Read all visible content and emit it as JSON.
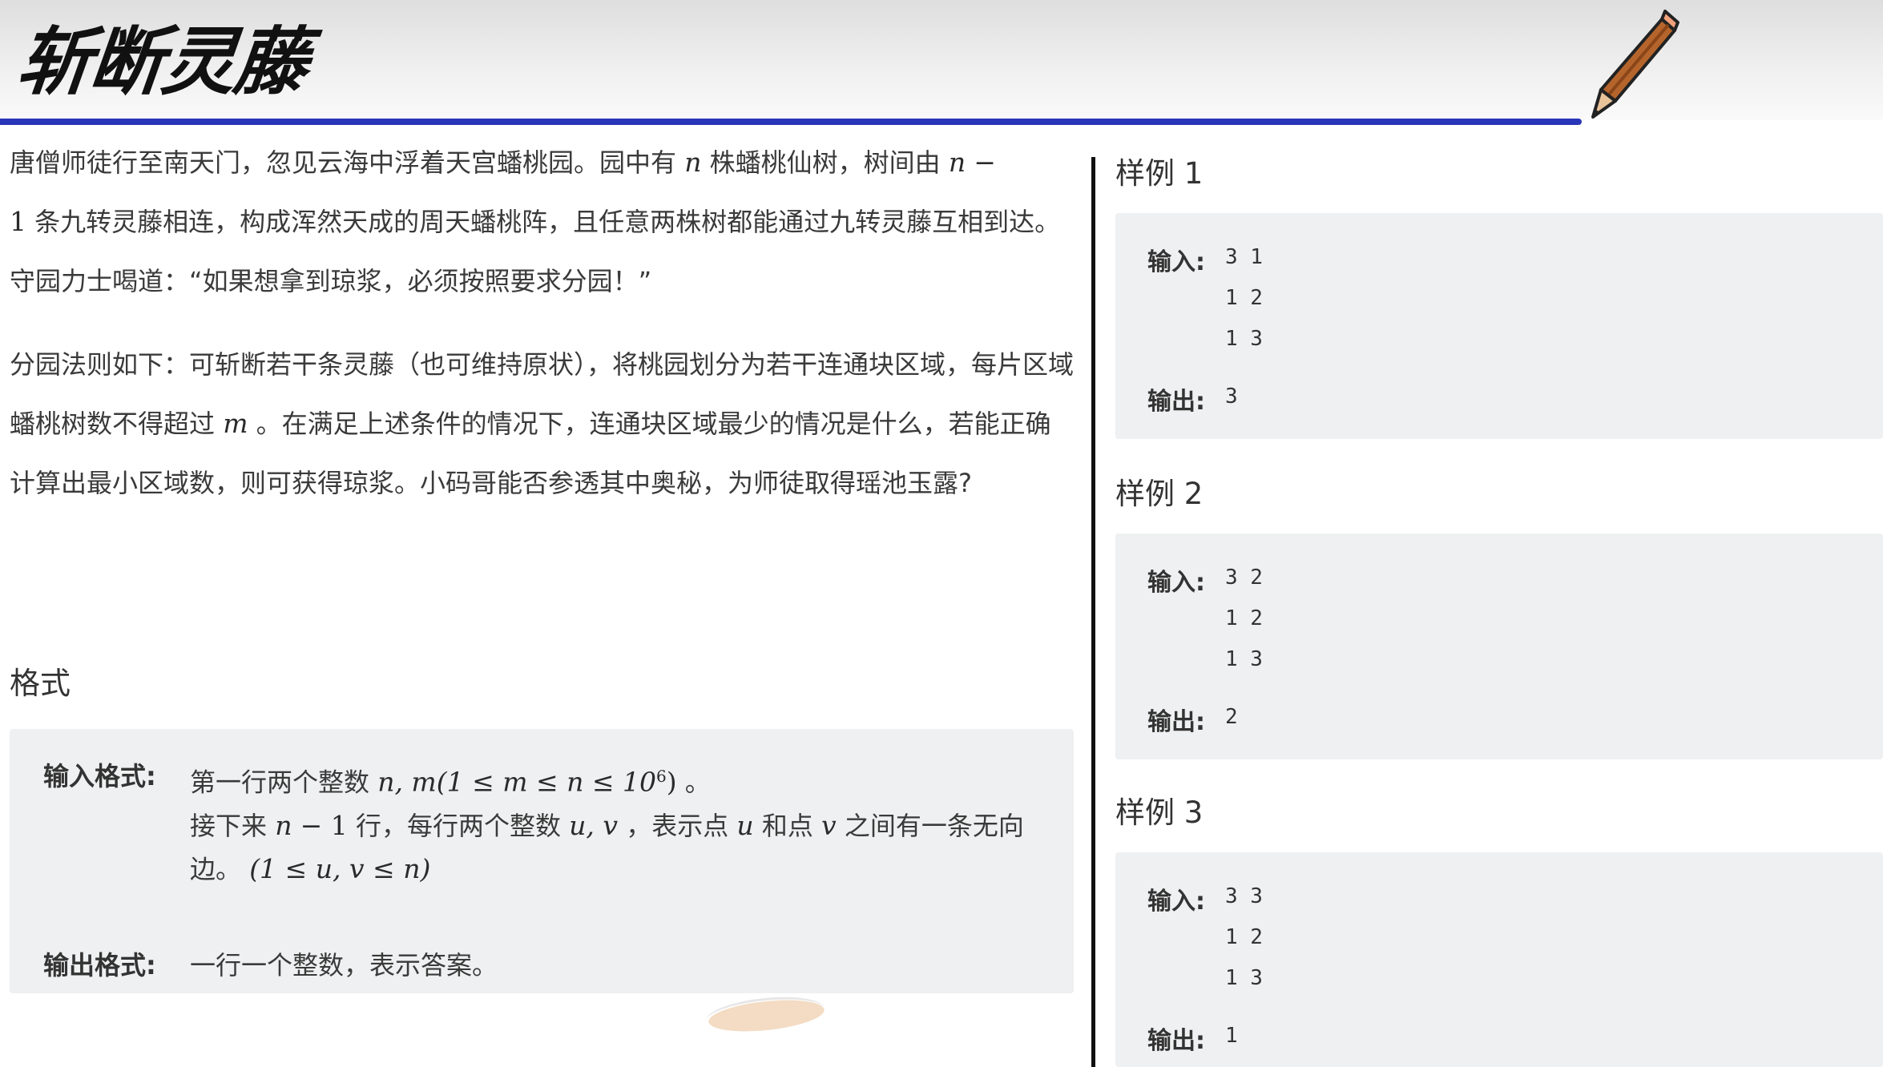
{
  "header": {
    "title": "斩断灵藤",
    "accent_color": "#2a36b8",
    "decoration_icon": "pencil-icon"
  },
  "statement": {
    "p1": {
      "t1": "唐僧师徒行至南天门，忽见云海中浮着天宫蟠桃园。园中有",
      "m1": "n",
      "t2": "株蟠桃仙树，树间由",
      "m2": "n",
      "m2b": "−",
      "m2c": "1",
      "t3": "条九转灵藤相连，构成浑然天成的周天蟠桃阵，且任意两株树都能通过九转灵藤互相到达。守园力士喝道：“如果想拿到琼浆，必须按照要求分园！”"
    },
    "p2": {
      "t1": "分园法则如下：可斩断若干条灵藤（也可维持原状），将桃园划分为若干连通块区域，每片区域蟠桃树数不得超过",
      "m1": "m",
      "t2": "。在满足上述条件的情况下，连通块区域最少的情况是什么，若能正确计算出最小区域数，则可获得琼浆。小码哥能否参透其中奥秘，为师徒取得瑶池玉露?"
    }
  },
  "format": {
    "section_title": "格式",
    "input_label": "输入格式:",
    "input_t1": "第一行两个整数",
    "input_m1": "n, m",
    "input_m2": "(1 ≤ m ≤ n ≤ 10",
    "input_m2_sup": "6",
    "input_m2_end": ")",
    "input_t2": "。",
    "input_t3": "接下来",
    "input_m3": "n",
    "input_m3b": "− 1",
    "input_t4": "行，每行两个整数",
    "input_m4": "u, v",
    "input_t5": "，表示点",
    "input_m5": "u",
    "input_t6": "和点",
    "input_m6": "v",
    "input_t7": "之间有一条无向边。",
    "input_m7": "(1 ≤ u, v ≤ n)",
    "output_label": "输出格式:",
    "output_text": "一行一个整数，表示答案。"
  },
  "samples": [
    {
      "title": "样例 1",
      "input_label": "输入:",
      "input_lines": [
        "3 1",
        "1 2",
        "1 3"
      ],
      "output_label": "输出:",
      "output": "3"
    },
    {
      "title": "样例 2",
      "input_label": "输入:",
      "input_lines": [
        "3 2",
        "1 2",
        "1 3"
      ],
      "output_label": "输出:",
      "output": "2"
    },
    {
      "title": "样例 3",
      "input_label": "输入:",
      "input_lines": [
        "3 3",
        "1 2",
        "1 3"
      ],
      "output_label": "输出:",
      "output": "1"
    }
  ]
}
